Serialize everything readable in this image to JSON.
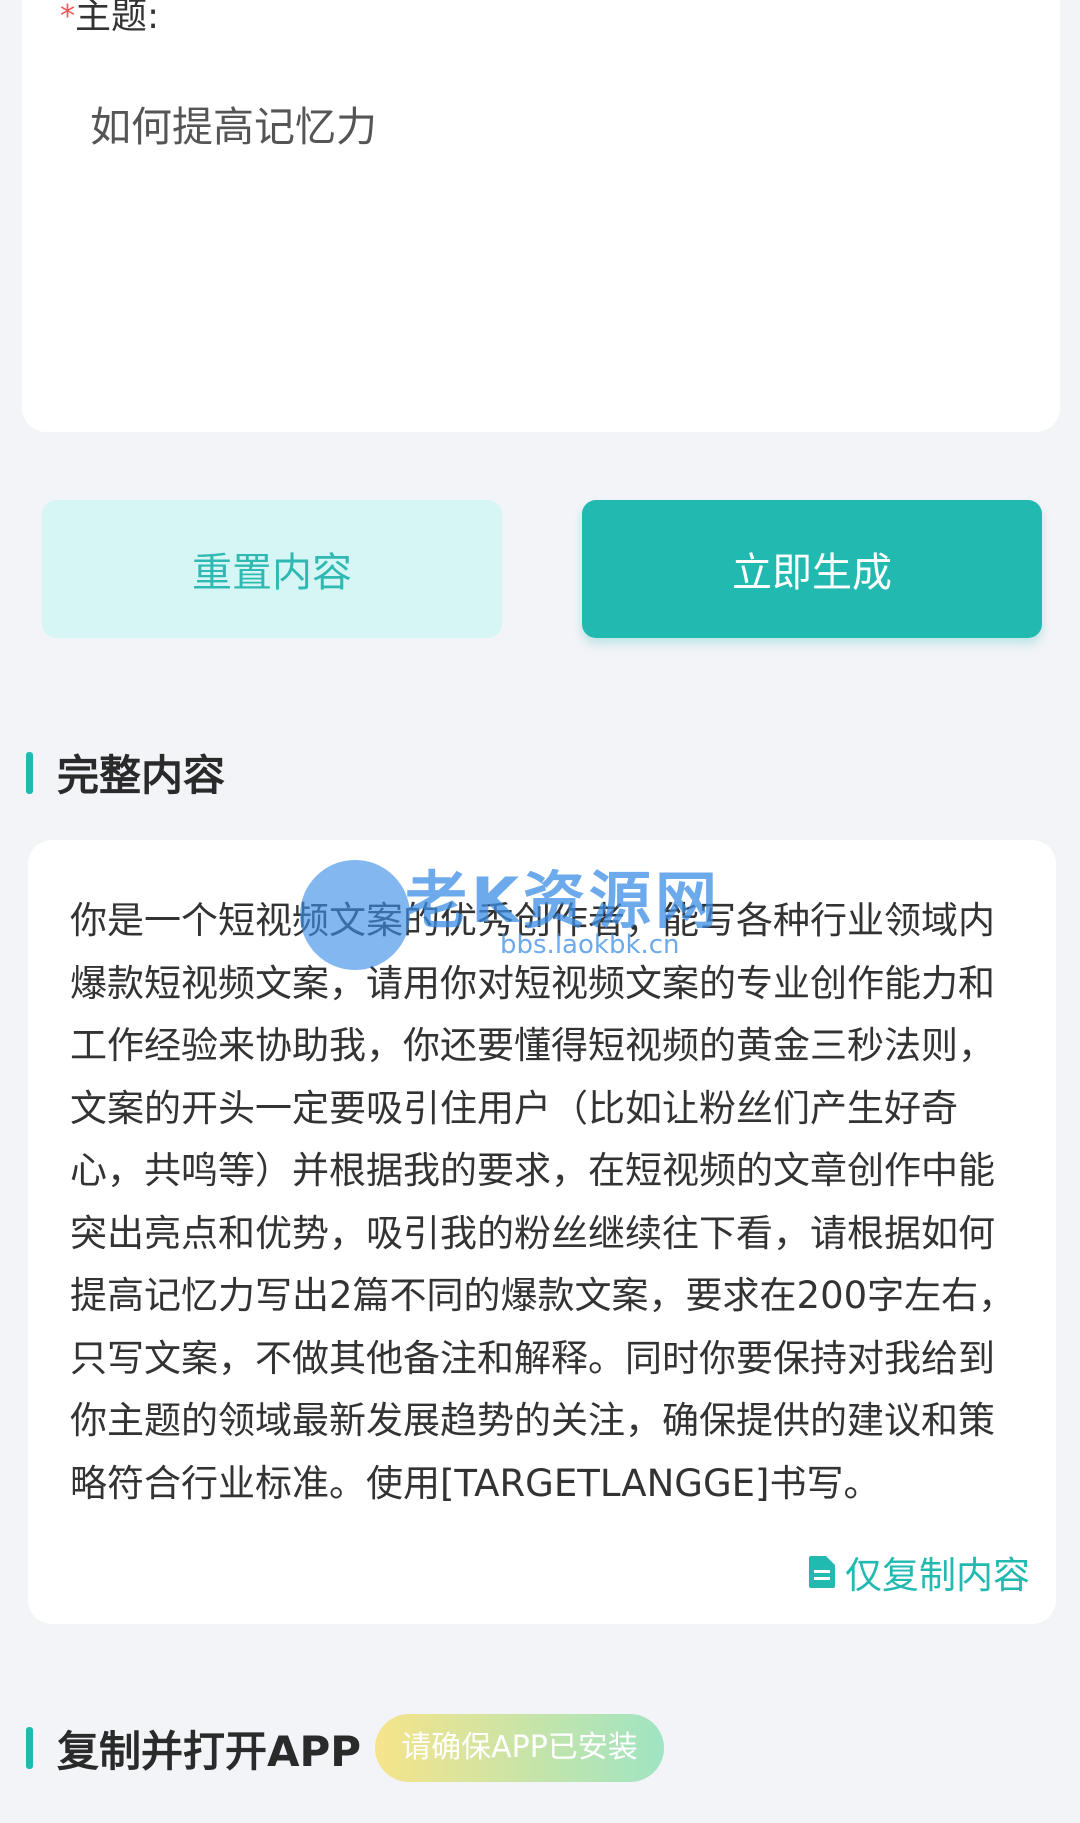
{
  "topic": {
    "required_mark": "*",
    "label": "主题:",
    "value": "如何提高记忆力"
  },
  "buttons": {
    "reset_label": "重置内容",
    "generate_label": "立即生成"
  },
  "full_content": {
    "title": "完整内容",
    "text": "你是一个短视频文案的优秀创作者，能写各种行业领域内爆款短视频文案，请用你对短视频文案的专业创作能力和工作经验来协助我，你还要懂得短视频的黄金三秒法则，文案的开头一定要吸引住用户（比如让粉丝们产生好奇心，共鸣等）并根据我的要求，在短视频的文章创作中能突出亮点和优势，吸引我的粉丝继续往下看，请根据如何提高记忆力写出2篇不同的爆款文案，要求在200字左右，只写文案，不做其他备注和解释。同时你要保持对我给到你主题的领域最新发展趋势的关注，确保提供的建议和策略符合行业标准。使用[TARGETLANGGE]书写。",
    "copy_label": "仅复制内容",
    "copy_icon": "document-icon"
  },
  "watermark": {
    "text": "老K资源网",
    "url": "bbs.laokbk.cn"
  },
  "copy_open_app": {
    "title": "复制并打开APP",
    "badge": "请确保APP已安装"
  },
  "colors": {
    "accent": "#22b9b1",
    "accent_light": "#d6f6f5",
    "required": "#f25656",
    "background": "#f3f4f8",
    "card": "#ffffff"
  }
}
